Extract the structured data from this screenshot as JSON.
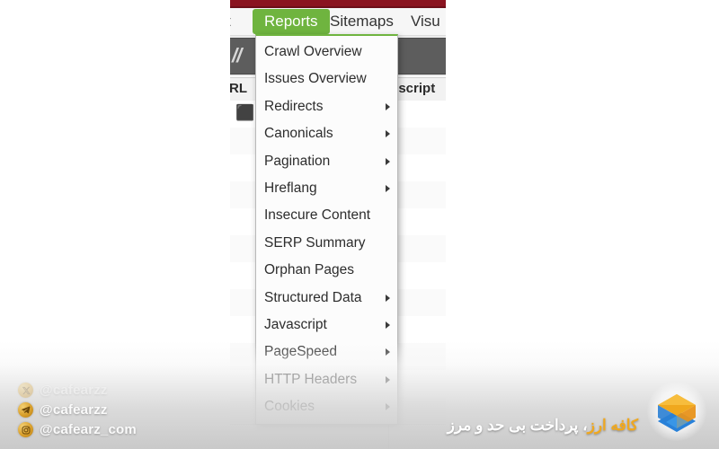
{
  "app": {
    "menubar": {
      "items": [
        {
          "label": "t",
          "name": "menubar-item-tools-partial",
          "active": false
        },
        {
          "label": "Reports",
          "name": "menubar-item-reports",
          "active": true
        },
        {
          "label": "Sitemaps",
          "name": "menubar-item-sitemaps",
          "active": false
        },
        {
          "label": "Visu",
          "name": "menubar-item-visualisations-partial",
          "active": false
        }
      ],
      "active_accent_color": "#6fb43f",
      "titlebar_color": "#8a1420"
    },
    "toolbar": {
      "url_fragment": "//"
    },
    "table": {
      "headers": [
        {
          "label": "RL",
          "name": "column-header-url-partial"
        },
        {
          "label": "escript",
          "name": "column-header-description-partial"
        }
      ]
    }
  },
  "reports_menu": {
    "items": [
      {
        "label": "Crawl Overview",
        "submenu": false
      },
      {
        "label": "Issues Overview",
        "submenu": false
      },
      {
        "label": "Redirects",
        "submenu": true
      },
      {
        "label": "Canonicals",
        "submenu": true
      },
      {
        "label": "Pagination",
        "submenu": true
      },
      {
        "label": "Hreflang",
        "submenu": true
      },
      {
        "label": "Insecure Content",
        "submenu": false
      },
      {
        "label": "SERP Summary",
        "submenu": false
      },
      {
        "label": "Orphan Pages",
        "submenu": false
      },
      {
        "label": "Structured Data",
        "submenu": true
      },
      {
        "label": "Javascript",
        "submenu": true
      },
      {
        "label": "PageSpeed",
        "submenu": true
      },
      {
        "label": "HTTP Headers",
        "submenu": true
      },
      {
        "label": "Cookies",
        "submenu": true
      }
    ]
  },
  "watermark": {
    "socials": [
      {
        "icon": "x-twitter-icon",
        "handle": "@cafearzz",
        "faded": true
      },
      {
        "icon": "telegram-icon",
        "handle": "@cafearzz",
        "faded": false
      },
      {
        "icon": "instagram-icon",
        "handle": "@cafearz_com",
        "faded": false
      }
    ],
    "tagline": {
      "brand": "کافه ارز",
      "rest": "، پرداخت بی حد و مرز"
    },
    "brand_color": "#f0a81e",
    "logo_name": "cafearz-cube-logo"
  }
}
